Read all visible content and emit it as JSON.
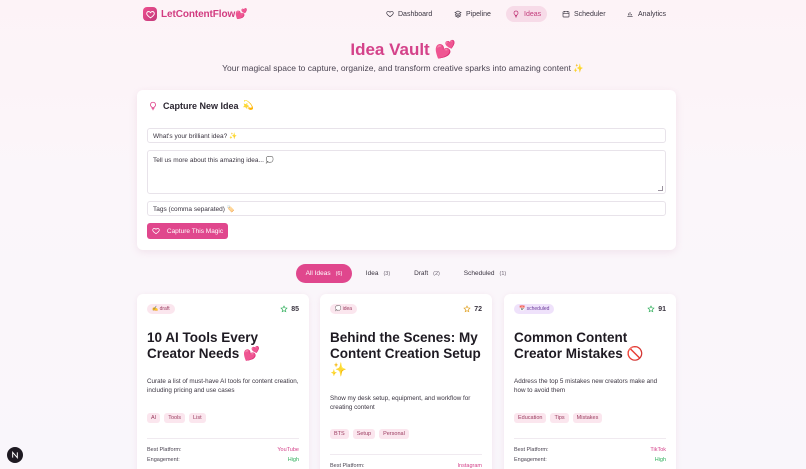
{
  "brand": {
    "name": "LetContentFlow",
    "heart": "💕"
  },
  "nav": [
    {
      "id": "dashboard",
      "label": "Dashboard",
      "icon": "heart-outline-icon",
      "active": false
    },
    {
      "id": "pipeline",
      "label": "Pipeline",
      "icon": "layers-icon",
      "active": false
    },
    {
      "id": "ideas",
      "label": "Ideas",
      "icon": "lightbulb-icon",
      "active": true
    },
    {
      "id": "scheduler",
      "label": "Scheduler",
      "icon": "calendar-icon",
      "active": false
    },
    {
      "id": "analytics",
      "label": "Analytics",
      "icon": "bar-chart-icon",
      "active": false
    }
  ],
  "header": {
    "title": "Idea Vault 💕",
    "subtitle": "Your magical space to capture, organize, and transform creative sparks into amazing content ✨"
  },
  "capture": {
    "heading": "Capture New Idea",
    "heading_emoji": "💫",
    "title_placeholder": "What's your brilliant idea? ✨",
    "description_placeholder": "Tell us more about this amazing idea... 💭",
    "tags_placeholder": "Tags (comma separated) 🏷️",
    "button_label": "Capture This Magic"
  },
  "filters": [
    {
      "label": "All Ideas",
      "count": "(6)",
      "active": true
    },
    {
      "label": "Idea",
      "count": "(3)",
      "active": false
    },
    {
      "label": "Draft",
      "count": "(2)",
      "active": false
    },
    {
      "label": "Scheduled",
      "count": "(1)",
      "active": false
    }
  ],
  "cards": [
    {
      "status": "✍️ draft",
      "status_type": "draft",
      "score": "85",
      "title": "10 AI Tools Every Creator Needs 💕",
      "description": "Curate a list of must-have AI tools for content creation, including pricing and use cases",
      "tags": [
        "AI",
        "Tools",
        "List"
      ],
      "best_platform_label": "Best Platform:",
      "best_platform": "YouTube",
      "engagement_label": "Engagement:",
      "engagement": "High"
    },
    {
      "status": "💭 idea",
      "status_type": "idea",
      "score": "72",
      "title": "Behind the Scenes: My Content Creation Setup ✨",
      "description": "Show my desk setup, equipment, and workflow for creating content",
      "tags": [
        "BTS",
        "Setup",
        "Personal"
      ],
      "best_platform_label": "Best Platform:",
      "best_platform": "Instagram",
      "engagement_label": "Engagement:",
      "engagement": ""
    },
    {
      "status": "📅 scheduled",
      "status_type": "scheduled",
      "score": "91",
      "title": "Common Content Creator Mistakes 🚫",
      "description": "Address the top 5 mistakes new creators make and how to avoid them",
      "tags": [
        "Education",
        "Tips",
        "Mistakes"
      ],
      "best_platform_label": "Best Platform:",
      "best_platform": "TikTok",
      "engagement_label": "Engagement:",
      "engagement": "High"
    }
  ],
  "fab_label": "N",
  "colors": {
    "brand": "#e0478d",
    "title": "#d4428a",
    "star": "#2eae5a"
  }
}
